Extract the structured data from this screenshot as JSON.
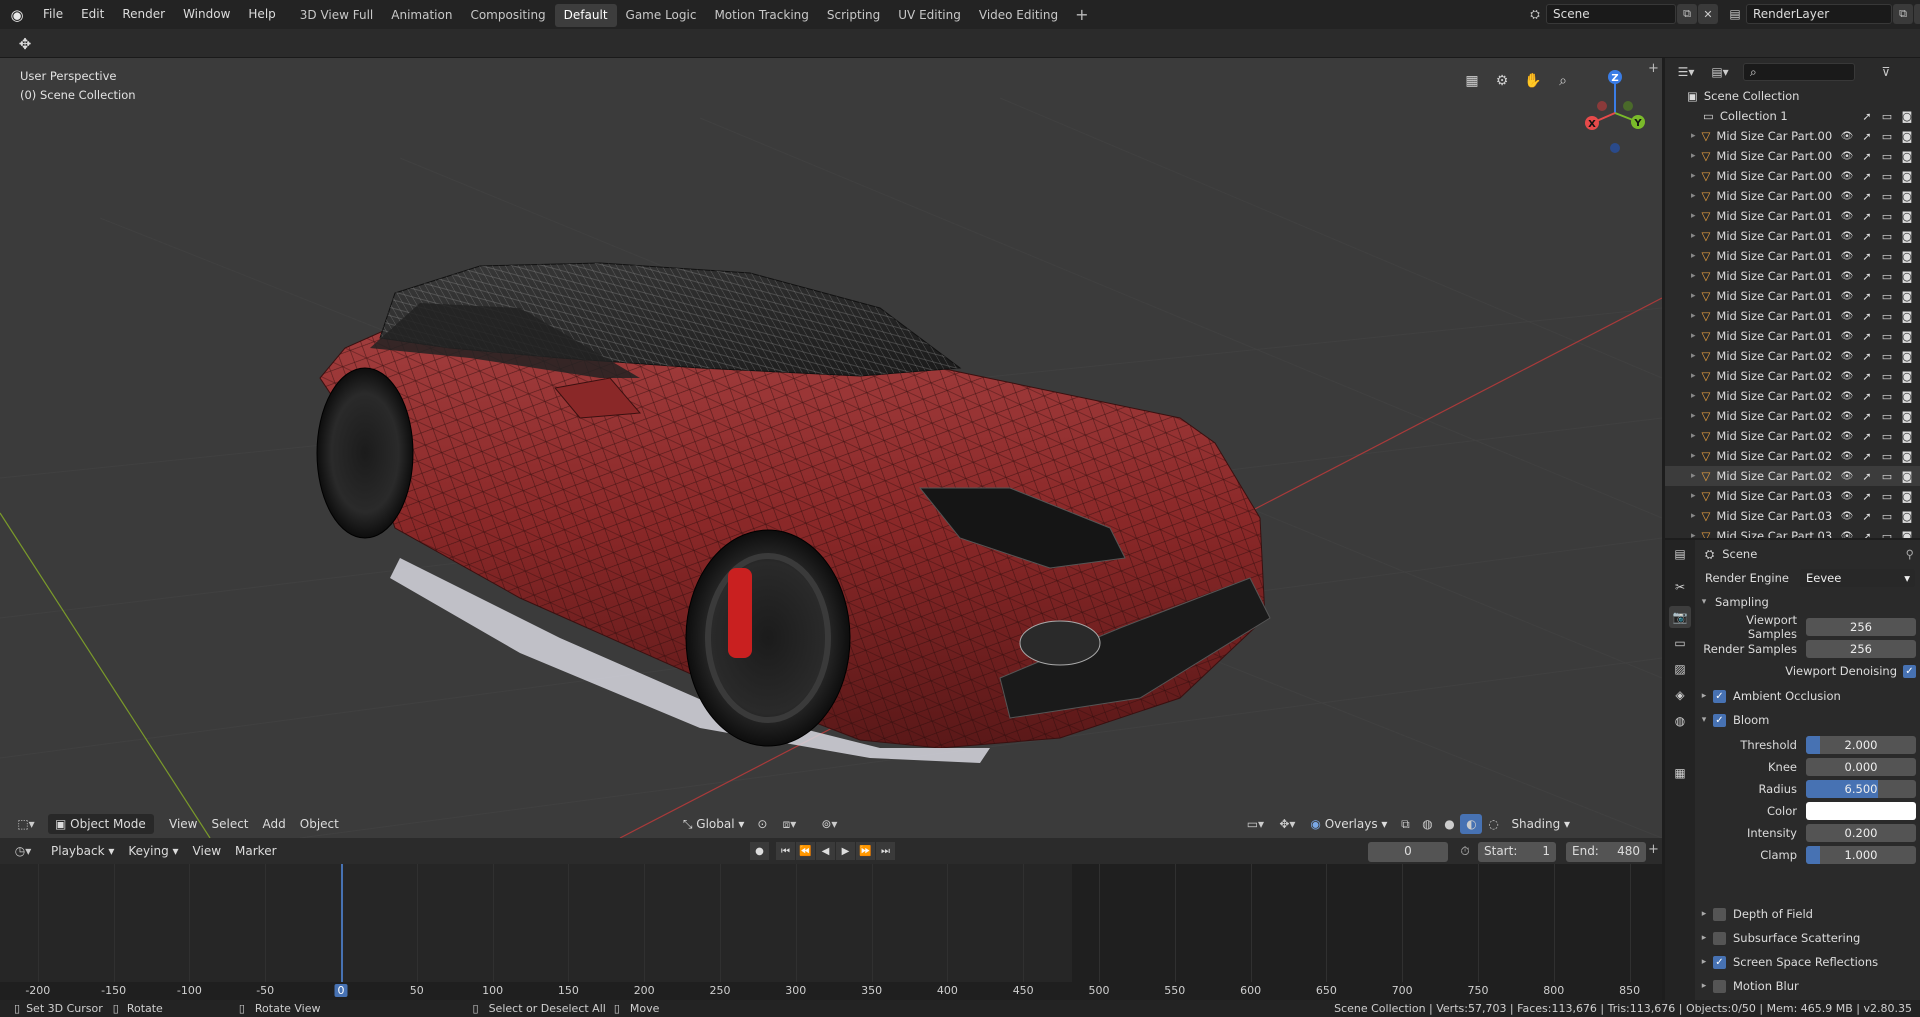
{
  "topbar": {
    "menus": [
      "File",
      "Edit",
      "Render",
      "Window",
      "Help"
    ],
    "workspaces": [
      "3D View Full",
      "Animation",
      "Compositing",
      "Default",
      "Game Logic",
      "Motion Tracking",
      "Scripting",
      "UV Editing",
      "Video Editing"
    ],
    "active_workspace": "Default",
    "scene": "Scene",
    "view_layer": "RenderLayer"
  },
  "viewport": {
    "perspective": "User Perspective",
    "collection": "(0) Scene Collection",
    "gizmo": {
      "x": "X",
      "y": "Y",
      "z": "Z"
    },
    "header": {
      "mode": "Object Mode",
      "menus": [
        "View",
        "Select",
        "Add",
        "Object"
      ],
      "orientation": "Global",
      "overlays": "Overlays",
      "shading": "Shading"
    }
  },
  "timeline": {
    "menus": [
      "Playback",
      "Keying",
      "View",
      "Marker"
    ],
    "current_frame": "0",
    "start_label": "Start:",
    "start": "1",
    "end_label": "End:",
    "end": "480",
    "ruler": [
      "-200",
      "-150",
      "-100",
      "-50",
      "0",
      "50",
      "100",
      "150",
      "200",
      "250",
      "300",
      "350",
      "400",
      "450",
      "500",
      "550",
      "600",
      "650",
      "700",
      "750",
      "800",
      "850"
    ]
  },
  "status": {
    "set_cursor": "Set 3D Cursor",
    "rotate": "Rotate",
    "rotate_view": "Rotate View",
    "select": "Select or Deselect All",
    "move": "Move",
    "info": "Scene Collection | Verts:57,703 | Faces:113,676 | Tris:113,676 | Objects:0/50 | Mem: 465.9 MB | v2.80.35"
  },
  "outliner": {
    "root": "Scene Collection",
    "collection": "Collection 1",
    "items": [
      "Mid Size Car Part.00",
      "Mid Size Car Part.00",
      "Mid Size Car Part.00",
      "Mid Size Car Part.00",
      "Mid Size Car Part.01",
      "Mid Size Car Part.01",
      "Mid Size Car Part.01",
      "Mid Size Car Part.01",
      "Mid Size Car Part.01",
      "Mid Size Car Part.01",
      "Mid Size Car Part.01",
      "Mid Size Car Part.02",
      "Mid Size Car Part.02",
      "Mid Size Car Part.02",
      "Mid Size Car Part.02",
      "Mid Size Car Part.02",
      "Mid Size Car Part.02",
      "Mid Size Car Part.02",
      "Mid Size Car Part.03",
      "Mid Size Car Part.03",
      "Mid Size Car Part.03"
    ],
    "selected_index": 17
  },
  "properties": {
    "context": "Scene",
    "render_engine_label": "Render Engine",
    "render_engine": "Eevee",
    "sampling": "Sampling",
    "viewport_samples_label": "Viewport Samples",
    "viewport_samples": "256",
    "render_samples_label": "Render Samples",
    "render_samples": "256",
    "viewport_denoising": "Viewport Denoising",
    "ambient_occlusion": "Ambient Occlusion",
    "bloom": "Bloom",
    "bloom_fields": [
      {
        "label": "Threshold",
        "value": "2.000",
        "fill": 0.06
      },
      {
        "label": "Knee",
        "value": "0.000",
        "fill": 0
      },
      {
        "label": "Radius",
        "value": "6.500",
        "fill": 0.65
      },
      {
        "label": "Color",
        "value": "",
        "fill": 0
      },
      {
        "label": "Intensity",
        "value": "0.200",
        "fill": 0
      },
      {
        "label": "Clamp",
        "value": "1.000",
        "fill": 0.02
      }
    ],
    "depth_of_field": "Depth of Field",
    "subsurface": "Subsurface Scattering",
    "ssr": "Screen Space Reflections",
    "motion_blur": "Motion Blur"
  },
  "colors": {
    "accent": "#4772b3",
    "car": "#8e2a2a",
    "grid_x": "#b03a3a",
    "grid_y": "#7a9a2a"
  }
}
